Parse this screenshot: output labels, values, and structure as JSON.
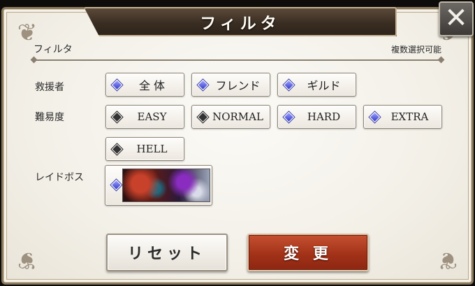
{
  "dialog": {
    "title": "フィルタ",
    "close_glyph": "✕"
  },
  "section": {
    "label": "フィルタ",
    "note": "複数選択可能"
  },
  "rows": {
    "helper_label": "救援者",
    "difficulty_label": "難易度",
    "raid_boss_label": "レイドボス"
  },
  "helper_options": [
    {
      "label": "全 体",
      "selected": true
    },
    {
      "label": "フレンド",
      "selected": true
    },
    {
      "label": "ギルド",
      "selected": true
    }
  ],
  "difficulty_options": [
    {
      "label": "EASY",
      "selected": false
    },
    {
      "label": "NORMAL",
      "selected": false
    },
    {
      "label": "HARD",
      "selected": true
    },
    {
      "label": "EXTRA",
      "selected": true
    },
    {
      "label": "HELL",
      "selected": false
    }
  ],
  "raid_boss": {
    "selected": true
  },
  "buttons": {
    "reset": "リセット",
    "apply": "変 更"
  },
  "colors": {
    "selected_diamond": "#3038c8",
    "unselected_diamond": "#333333",
    "apply_button": "#a23218",
    "title_bar": "#3a2d22"
  }
}
